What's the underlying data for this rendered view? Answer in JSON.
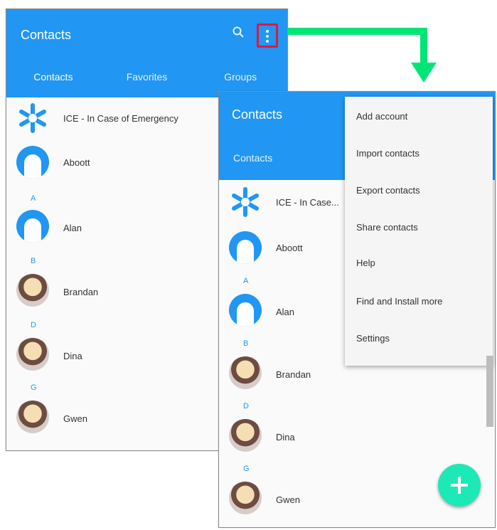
{
  "screen1": {
    "app_title": "Contacts",
    "tabs": [
      "Contacts",
      "Favorites",
      "Groups"
    ],
    "ice_label": "ICE - In Case of Emergency",
    "contacts": [
      {
        "name": "Aboott",
        "avatar": "generic"
      },
      {
        "letter": "A"
      },
      {
        "name": "Alan",
        "avatar": "generic"
      },
      {
        "letter": "B"
      },
      {
        "name": "Brandan",
        "avatar": "person"
      },
      {
        "letter": "D"
      },
      {
        "name": "Dina",
        "avatar": "person"
      },
      {
        "letter": "G"
      },
      {
        "name": "Gwen",
        "avatar": "person"
      }
    ]
  },
  "screen2": {
    "app_title": "Contacts",
    "tab_active": "Contacts",
    "ice_label": "ICE - In Case...",
    "contacts": [
      {
        "name": "Aboott",
        "avatar": "generic"
      },
      {
        "letter": "A"
      },
      {
        "name": "Alan",
        "avatar": "generic"
      },
      {
        "letter": "B"
      },
      {
        "name": "Brandan",
        "avatar": "person"
      },
      {
        "letter": "D"
      },
      {
        "name": "Dina",
        "avatar": "person"
      },
      {
        "letter": "G"
      },
      {
        "name": "Gwen",
        "avatar": "person"
      }
    ]
  },
  "overflow_menu": {
    "items": [
      "Add account",
      "Import contacts",
      "Export contacts",
      "Share contacts",
      "Help",
      "Find and Install more",
      "Settings"
    ]
  },
  "colors": {
    "appbar": "#2196f3",
    "highlight": "#d81b43",
    "arrow": "#00e676",
    "fab": "#1de9b6"
  },
  "icons": {
    "search": "search-icon",
    "menu": "more-vert-icon",
    "add": "add-icon"
  }
}
